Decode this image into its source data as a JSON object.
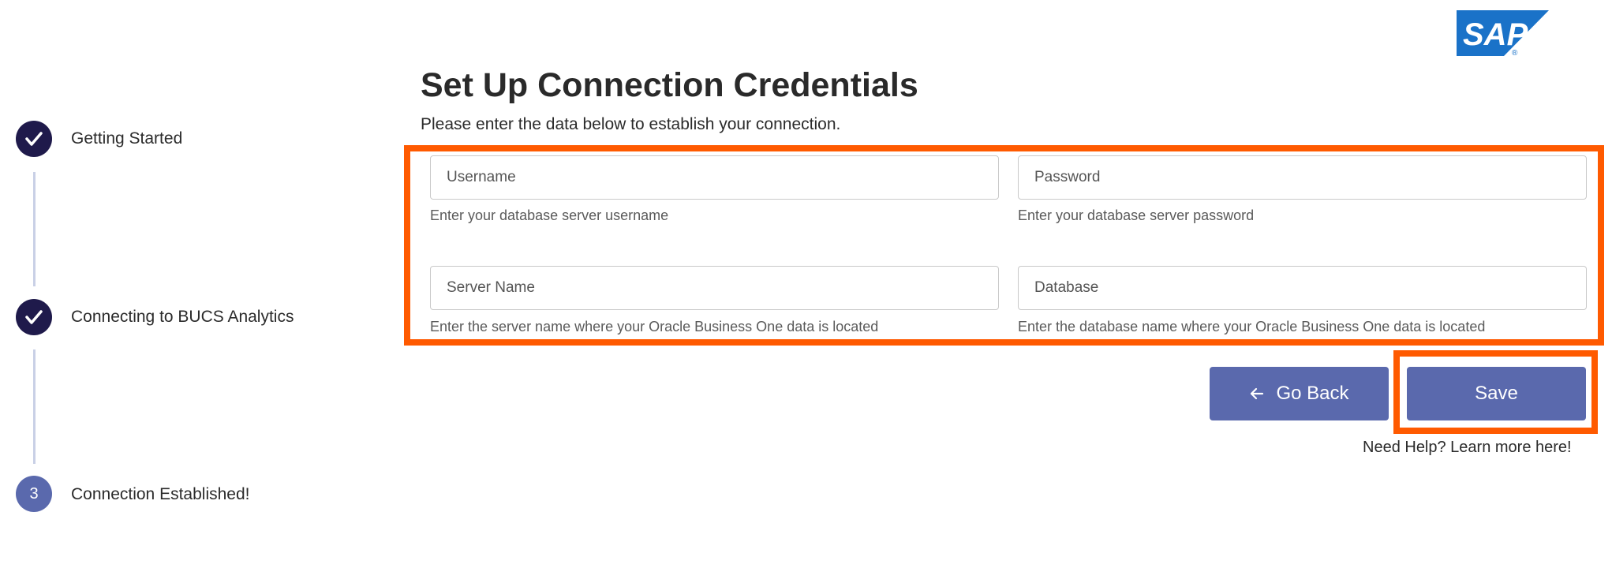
{
  "brand": {
    "logo_text": "SAP",
    "logo_color": "#1a72c8"
  },
  "colors": {
    "accent": "#5a69ad",
    "step_done": "#1f1a4b",
    "highlight": "#ff5a00"
  },
  "stepper": {
    "steps": [
      {
        "label": "Getting Started",
        "status": "done",
        "icon": "checkmark-icon"
      },
      {
        "label": "Connecting to BUCS Analytics",
        "status": "done",
        "icon": "checkmark-icon"
      },
      {
        "label": "Connection Established!",
        "status": "current",
        "number": "3"
      }
    ]
  },
  "header": {
    "title": "Set Up Connection Credentials",
    "subtitle": "Please enter the data below to establish your connection."
  },
  "form": {
    "username": {
      "placeholder": "Username",
      "value": "",
      "hint": "Enter your database server username"
    },
    "password": {
      "placeholder": "Password",
      "value": "",
      "hint": "Enter your database server password"
    },
    "server_name": {
      "placeholder": "Server Name",
      "value": "",
      "hint": "Enter the server name where your Oracle Business One data is located"
    },
    "database": {
      "placeholder": "Database",
      "value": "",
      "hint": "Enter the database name where your Oracle Business One data is located"
    }
  },
  "actions": {
    "back_label": "Go Back",
    "back_icon": "arrow-left-icon",
    "save_label": "Save",
    "help_text": "Need Help? Learn more here!"
  }
}
